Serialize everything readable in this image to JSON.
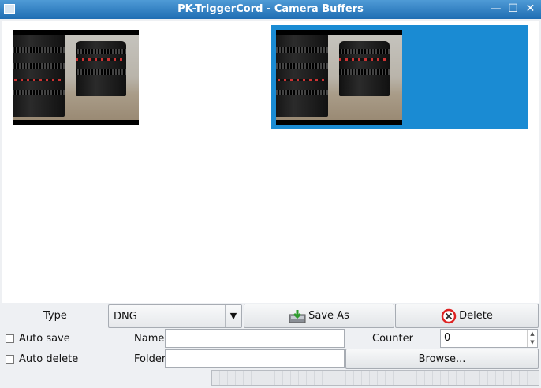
{
  "window": {
    "title": "PK-TriggerCord - Camera Buffers",
    "controls": [
      "minimize-icon",
      "maximize-icon",
      "close-icon"
    ]
  },
  "buffers": [
    {
      "name": "buffer-thumbnail-1",
      "selected": false
    },
    {
      "name": "buffer-thumbnail-2",
      "selected": true
    }
  ],
  "controls": {
    "type_label": "Type",
    "type_value": "DNG",
    "save_as_label": "Save As",
    "delete_label": "Delete",
    "auto_save_label": "Auto save",
    "auto_delete_label": "Auto delete",
    "name_label": "Name",
    "name_value": "",
    "counter_label": "Counter",
    "counter_value": "0",
    "folder_label": "Folder",
    "folder_value": "",
    "browse_label": "Browse..."
  },
  "colors": {
    "selection": "#1a8bd3",
    "titlebar": "#2f7fc4"
  }
}
